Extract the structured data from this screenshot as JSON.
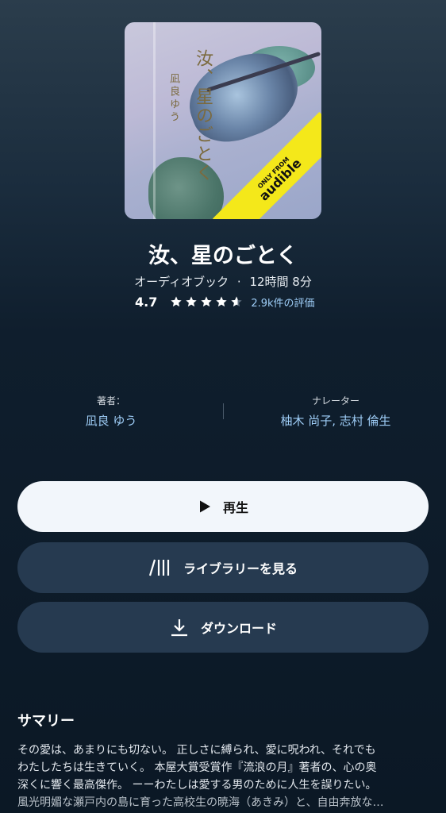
{
  "book": {
    "cover": {
      "vertical_title": "汝、星のごとく",
      "vertical_author": "凪良ゆう",
      "badge_small": "ONLY FROM",
      "badge_big": "audible",
      "badge_color": "#f4e81a"
    },
    "title": "汝、星のごとく",
    "format": "オーディオブック",
    "separator": "·",
    "duration": "12時間 8分",
    "rating": {
      "value": "4.7",
      "stars": 4.7,
      "count_label": "2.9k件の評価"
    }
  },
  "credits": {
    "author_label": "著者：",
    "author": "凪良 ゆう",
    "narrator_label": "ナレーター",
    "narrators": "柚木 尚子, 志村 倫生"
  },
  "buttons": {
    "play": "再生",
    "library": "ライブラリーを見る",
    "download": "ダウンロード"
  },
  "summary": {
    "heading": "サマリー",
    "lines": [
      "その愛は、あまりにも切ない。 正しさに縛られ、愛に呪われ、それでも",
      "わたしたちは生きていく。 本屋大賞受賞作『流浪の月』著者の、心の奥",
      "深くに響く最高傑作。 ーーわたしは愛する男のために人生を誤りたい。",
      "風光明媚な瀬戸内の島に育った高校生の暁海（あきみ）と、自由奔放な…"
    ]
  },
  "colors": {
    "accent_link": "#9ecdf7",
    "button_dark": "#263a50",
    "button_light": "#f2f6fb"
  }
}
